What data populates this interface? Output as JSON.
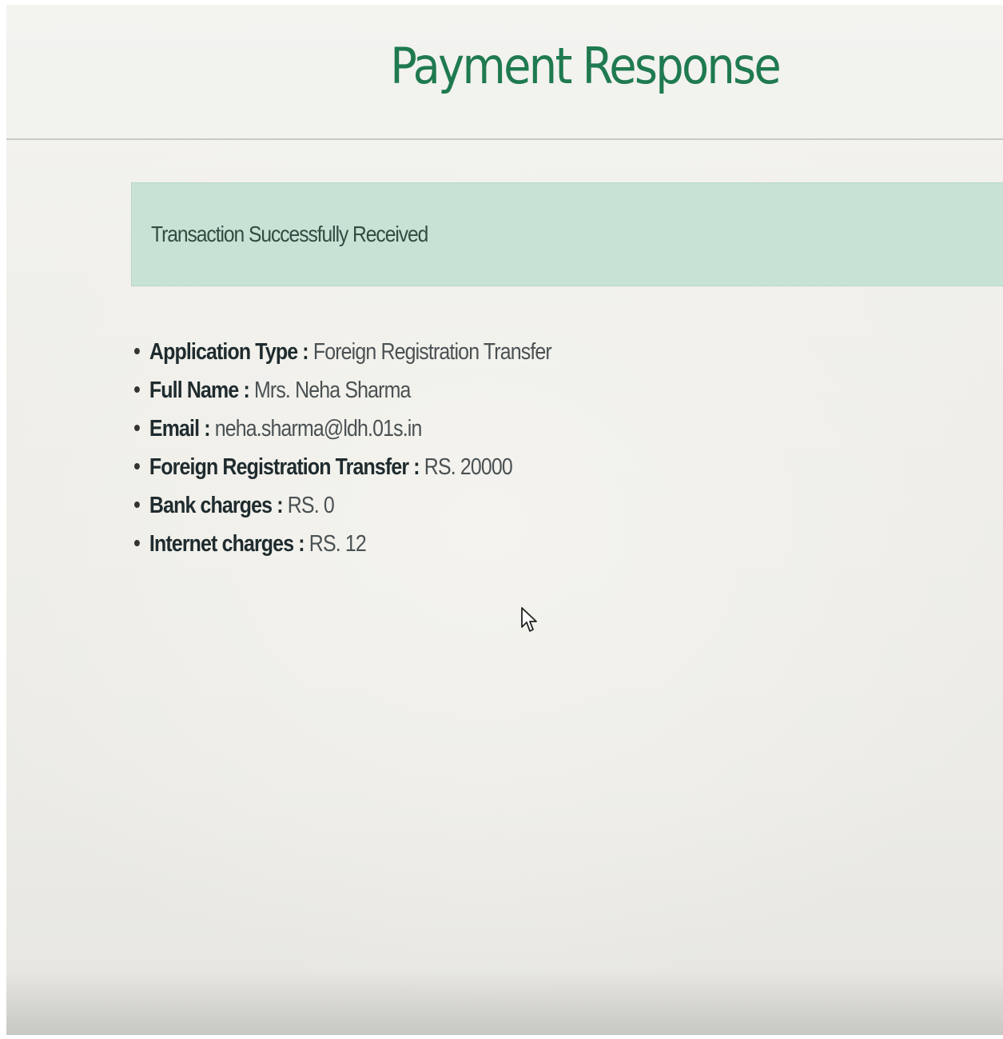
{
  "page": {
    "title": "Payment Response"
  },
  "alert": {
    "message": "Transaction Successfully Received"
  },
  "details": [
    {
      "label": "Application Type",
      "separator": " : ",
      "value": "Foreign Registration Transfer"
    },
    {
      "label": "Full Name",
      "separator": " : ",
      "value": "Mrs. Neha Sharma"
    },
    {
      "label": "Email",
      "separator": " : ",
      "value": "neha.sharma@ldh.01s.in"
    },
    {
      "label": "Foreign Registration Transfer",
      "separator": " : ",
      "value": "RS. 20000"
    },
    {
      "label": "Bank charges",
      "separator": " : ",
      "value": "RS. 0"
    },
    {
      "label": "Internet charges",
      "separator": " : ",
      "value": "RS. 12"
    }
  ],
  "colors": {
    "title": "#1f7a4f",
    "alert_background": "#c9e2d6",
    "alert_text": "#2f4e40"
  },
  "icons": {
    "cursor": "mouse-pointer-icon"
  }
}
